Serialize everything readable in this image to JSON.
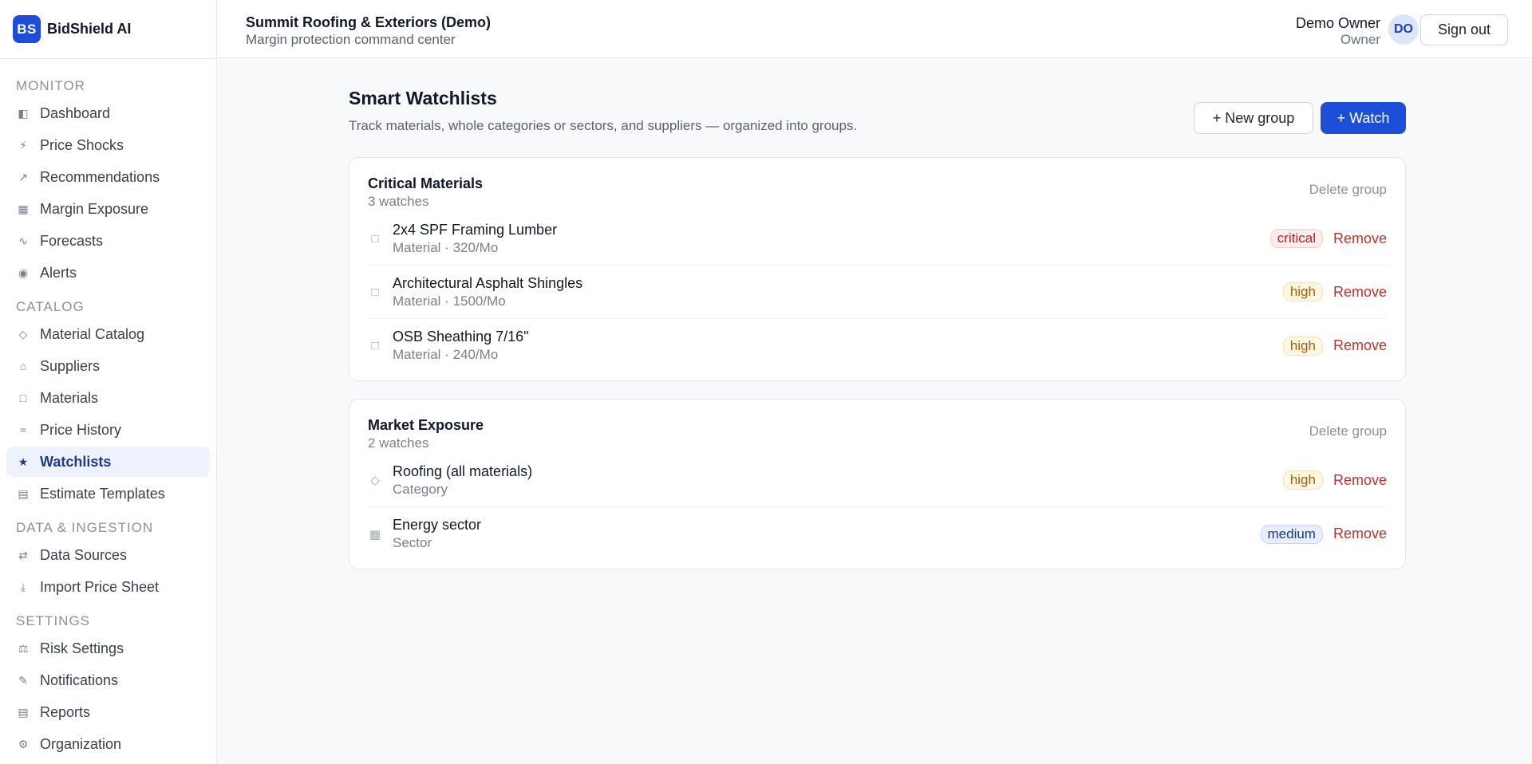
{
  "brand": {
    "logo": "BS",
    "name": "BidShield AI"
  },
  "topbar": {
    "org_name": "Summit Roofing & Exteriors (Demo)",
    "org_sub": "Margin protection command center",
    "user_name": "Demo Owner",
    "user_role": "Owner",
    "avatar": "DO",
    "signout": "Sign out"
  },
  "sidebar": {
    "monitor_label": "MONITOR",
    "monitor": [
      {
        "label": "Dashboard",
        "icon": "dashboard-icon",
        "glyph": "◧"
      },
      {
        "label": "Price Shocks",
        "icon": "lightning-icon",
        "glyph": "⚡"
      },
      {
        "label": "Recommendations",
        "icon": "arrow-up-right-icon",
        "glyph": "↗"
      },
      {
        "label": "Margin Exposure",
        "icon": "grid-icon",
        "glyph": "▦"
      },
      {
        "label": "Forecasts",
        "icon": "trend-icon",
        "glyph": "∿"
      },
      {
        "label": "Alerts",
        "icon": "alert-dot-icon",
        "glyph": "◉"
      }
    ],
    "catalog_label": "CATALOG",
    "catalog": [
      {
        "label": "Material Catalog",
        "icon": "diamond-icon",
        "glyph": "◇"
      },
      {
        "label": "Suppliers",
        "icon": "home-icon",
        "glyph": "⌂"
      },
      {
        "label": "Materials",
        "icon": "square-icon",
        "glyph": "□"
      },
      {
        "label": "Price History",
        "icon": "approx-icon",
        "glyph": "≈"
      },
      {
        "label": "Watchlists",
        "icon": "star-icon",
        "glyph": "★"
      },
      {
        "label": "Estimate Templates",
        "icon": "template-icon",
        "glyph": "▤"
      }
    ],
    "data_label": "DATA & INGESTION",
    "data": [
      {
        "label": "Data Sources",
        "icon": "exchange-icon",
        "glyph": "⇄"
      },
      {
        "label": "Import Price Sheet",
        "icon": "download-icon",
        "glyph": "⤓"
      }
    ],
    "settings_label": "SETTINGS",
    "settings": [
      {
        "label": "Risk Settings",
        "icon": "scale-icon",
        "glyph": "⚖"
      },
      {
        "label": "Notifications",
        "icon": "pencil-icon",
        "glyph": "✎"
      },
      {
        "label": "Reports",
        "icon": "report-icon",
        "glyph": "▤"
      },
      {
        "label": "Organization",
        "icon": "gear-icon",
        "glyph": "⚙"
      }
    ]
  },
  "page": {
    "title": "Smart Watchlists",
    "subtitle": "Track materials, whole categories or sectors, and suppliers — organized into groups.",
    "new_group": "+ New group",
    "watch": "+ Watch"
  },
  "groups": [
    {
      "name": "Critical Materials",
      "count": "3 watches",
      "delete": "Delete group",
      "items": [
        {
          "name": "2x4 SPF Framing Lumber",
          "meta": "Material · 320/Mo",
          "badge": "critical",
          "remove": "Remove",
          "icon": "square-icon",
          "glyph": "□"
        },
        {
          "name": "Architectural Asphalt Shingles",
          "meta": "Material · 1500/Mo",
          "badge": "high",
          "remove": "Remove",
          "icon": "square-icon",
          "glyph": "□"
        },
        {
          "name": "OSB Sheathing 7/16\"",
          "meta": "Material · 240/Mo",
          "badge": "high",
          "remove": "Remove",
          "icon": "square-icon",
          "glyph": "□"
        }
      ]
    },
    {
      "name": "Market Exposure",
      "count": "2 watches",
      "delete": "Delete group",
      "items": [
        {
          "name": "Roofing (all materials)",
          "meta": "Category",
          "badge": "high",
          "remove": "Remove",
          "icon": "diamond-icon",
          "glyph": "◇"
        },
        {
          "name": "Energy sector",
          "meta": "Sector",
          "badge": "medium",
          "remove": "Remove",
          "icon": "grid-icon",
          "glyph": "▦"
        }
      ]
    }
  ]
}
